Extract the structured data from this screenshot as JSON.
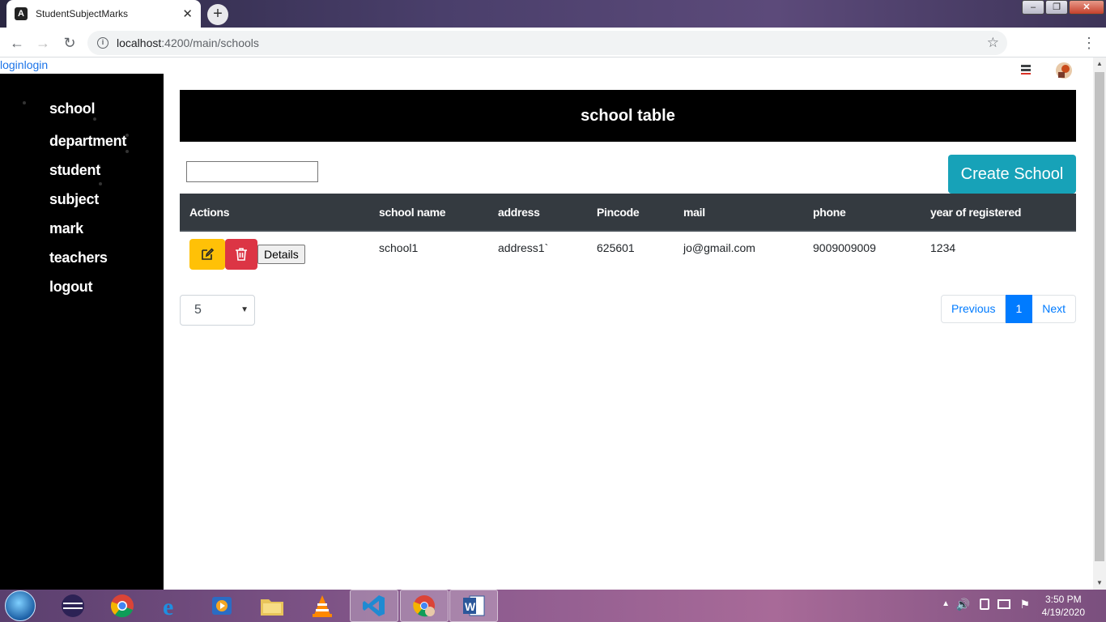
{
  "browser": {
    "tab_title": "StudentSubjectMarks",
    "tab_close": "✕",
    "new_tab": "+",
    "url_host": "localhost",
    "url_path": ":4200/main/schools",
    "window_controls": {
      "minimize": "–",
      "maximize": "❐",
      "close": "✕"
    }
  },
  "page": {
    "login_links": "loginlogin",
    "sidebar": {
      "items": [
        "school",
        "department",
        "student",
        "subject",
        "mark",
        "teachers",
        "logout"
      ]
    },
    "banner_title": "school table",
    "search": {
      "value": "",
      "placeholder": ""
    },
    "create_button": "Create School",
    "table": {
      "headers": [
        "Actions",
        "school name",
        "address",
        "Pincode",
        "mail",
        "phone",
        "year of registered"
      ],
      "rows": [
        {
          "details_label": "Details",
          "school_name": "school1",
          "address": "address1`",
          "pincode": "625601",
          "mail": "jo@gmail.com",
          "phone": "9009009009",
          "year": "1234"
        }
      ]
    },
    "page_size": "5",
    "pagination": {
      "previous": "Previous",
      "current": "1",
      "next": "Next"
    }
  },
  "taskbar": {
    "time": "3:50 PM",
    "date": "4/19/2020"
  },
  "colors": {
    "create_button": "#17a2b8",
    "edit_button": "#ffc107",
    "delete_button": "#dc3545",
    "table_header": "#343a40",
    "pager_active": "#007bff"
  }
}
